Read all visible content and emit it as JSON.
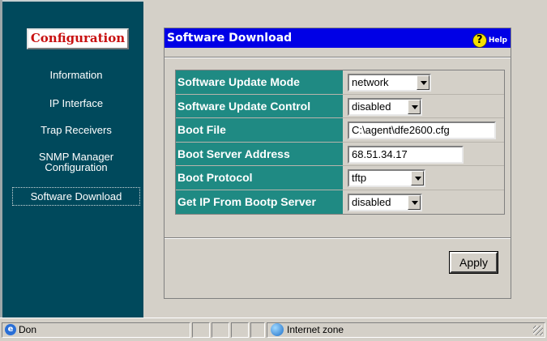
{
  "sidebar": {
    "config_button": "Configuration",
    "items": [
      {
        "label": "Information"
      },
      {
        "label": "IP Interface"
      },
      {
        "label": "Trap Receivers"
      },
      {
        "label": "SNMP Manager Configuration"
      },
      {
        "label": "Software Download"
      }
    ]
  },
  "panel": {
    "title": "Software Download",
    "help_label": "Help",
    "help_icon": "help-question-icon",
    "fields": [
      {
        "label": "Software Update Mode",
        "type": "select",
        "value": "network"
      },
      {
        "label": "Software Update Control",
        "type": "select",
        "value": "disabled"
      },
      {
        "label": "Boot File",
        "type": "text",
        "value": "C:\\agent\\dfe2600.cfg"
      },
      {
        "label": "Boot Server Address",
        "type": "text",
        "value": "68.51.34.17"
      },
      {
        "label": "Boot Protocol",
        "type": "select",
        "value": "tftp"
      },
      {
        "label": "Get IP From Bootp Server",
        "type": "select",
        "value": "disabled"
      }
    ],
    "apply_label": "Apply"
  },
  "statusbar": {
    "status_text": "Don",
    "zone_text": "Internet zone"
  },
  "colors": {
    "sidebar_bg": "#00495c",
    "title_bar": "#0000e6",
    "label_bg": "#1f8a83",
    "config_text": "#c81010"
  }
}
